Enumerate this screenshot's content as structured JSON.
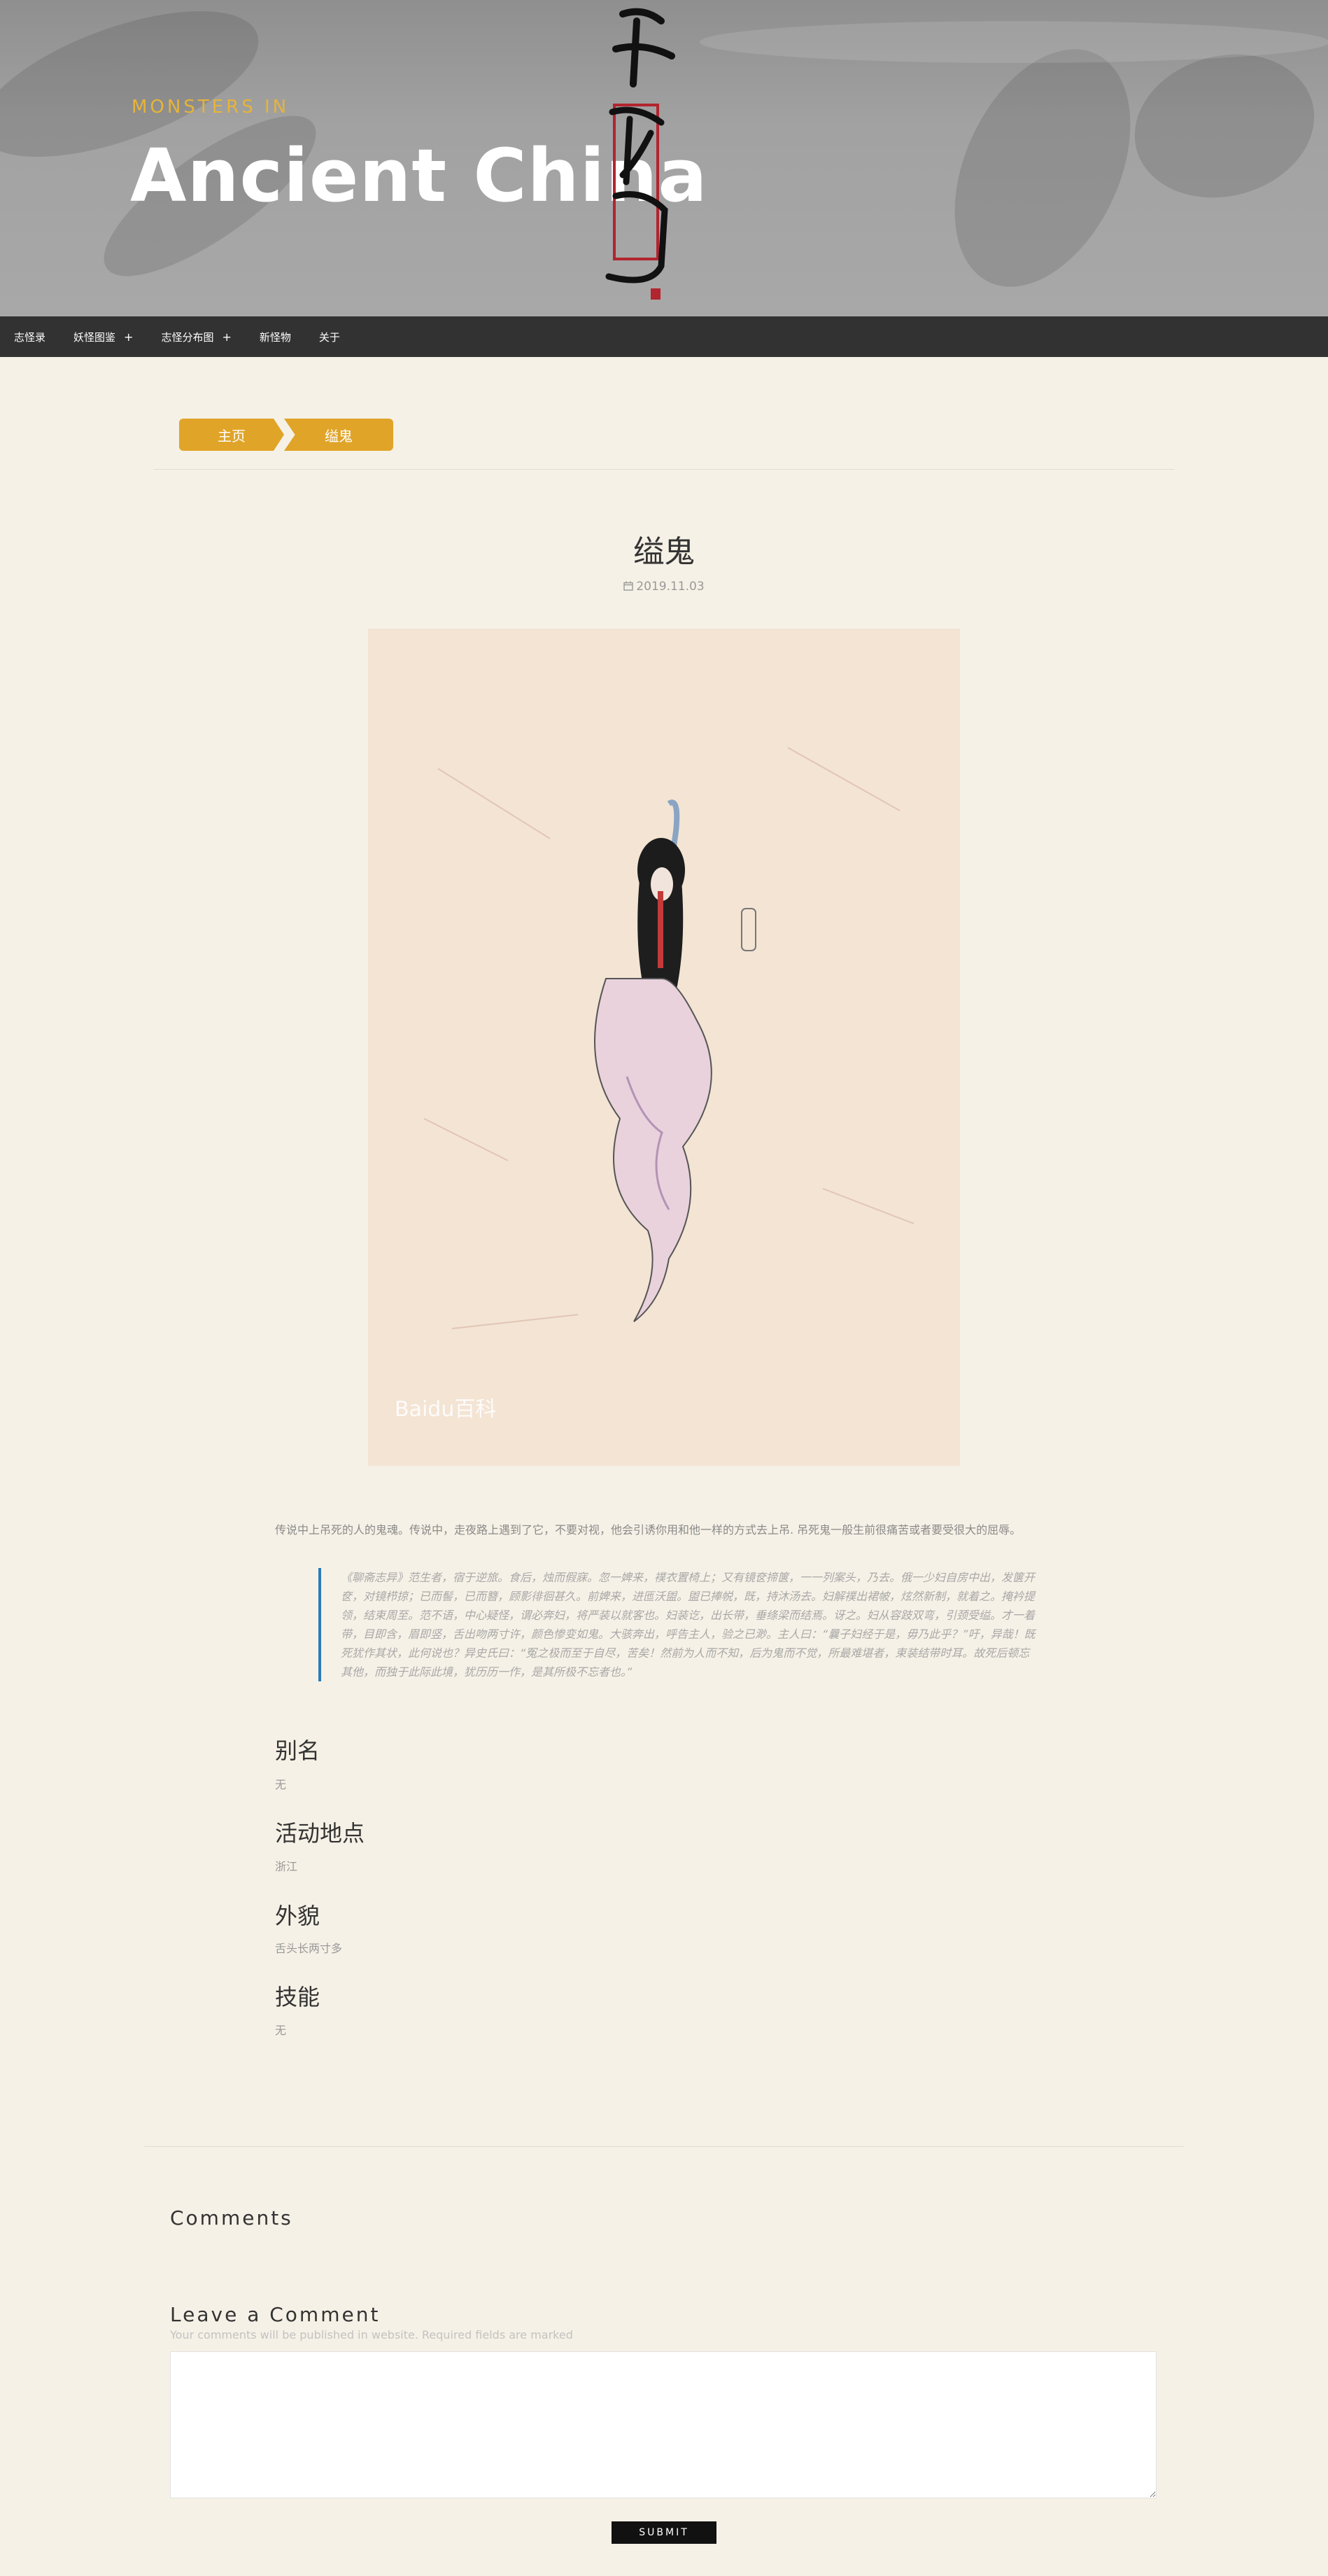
{
  "header": {
    "subtitle": "MONSTERS IN",
    "title": "Ancient China"
  },
  "nav": {
    "items": [
      {
        "label": "志怪录",
        "has_submenu": false
      },
      {
        "label": "妖怪图鉴",
        "has_submenu": true
      },
      {
        "label": "志怪分布图",
        "has_submenu": true
      },
      {
        "label": "新怪物",
        "has_submenu": false
      },
      {
        "label": "关于",
        "has_submenu": false
      }
    ],
    "submenu_symbol": "+"
  },
  "breadcrumb": {
    "home": "主页",
    "current": "缢鬼"
  },
  "post": {
    "title": "缢鬼",
    "date": "2019.11.03",
    "date_icon": "calendar-icon",
    "image_watermark": "Baidu百科",
    "intro": "传说中上吊死的人的鬼魂。传说中，走夜路上遇到了它，不要对视，他会引诱你用和他一样的方式去上吊. 吊死鬼一般生前很痛苦或者要受很大的屈辱。",
    "quote": "《聊斋志异》范生者，宿于逆旅。食后，烛而假寐。忽一婢来，襆衣置椅上；又有镜奁揥箧，一一列案头，乃去。俄一少妇自房中出，发箧开奁，对镜栉掠；已而髻，已而簪，顾影徘徊甚久。前婢来，进匜沃盥。盥已捧帨，既，持沐汤去。妇解襆出裙帔，炫然新制，就着之。掩衿提领，结束周至。范不语，中心疑怪，谓必奔妇，将严装以就客也。妇装讫，出长带，垂绦梁而结焉。讶之。妇从容跂双弯，引颈受缢。才一着带，目即含，眉即竖，舌出吻两寸许，颜色惨变如鬼。大骇奔出，呼告主人，验之已渺。主人曰：“曩子妇经于是，毋乃此乎？”吁，异哉！既死犹作其状，此何说也？异史氏曰：“冤之极而至于自尽，苦矣！然前为人而不知，后为鬼而不觉，所最难堪者，束装结带时耳。故死后顿忘其他，而独于此际此境，犹历历一作，是其所极不忘者也。”"
  },
  "fields": [
    {
      "label": "别名",
      "value": "无"
    },
    {
      "label": "活动地点",
      "value": "浙江"
    },
    {
      "label": "外貌",
      "value": "舌头长两寸多"
    },
    {
      "label": "技能",
      "value": "无"
    }
  ],
  "comments": {
    "title": "Comments",
    "leave_title": "Leave a Comment",
    "note": "Your comments will be published in website. Required fields are marked",
    "submit": "SUBMIT"
  },
  "colors": {
    "accent_gold": "#e0a428",
    "nav_bg": "#323232",
    "quote_border": "#2a7db8",
    "page_bg": "#f6f1e6"
  }
}
